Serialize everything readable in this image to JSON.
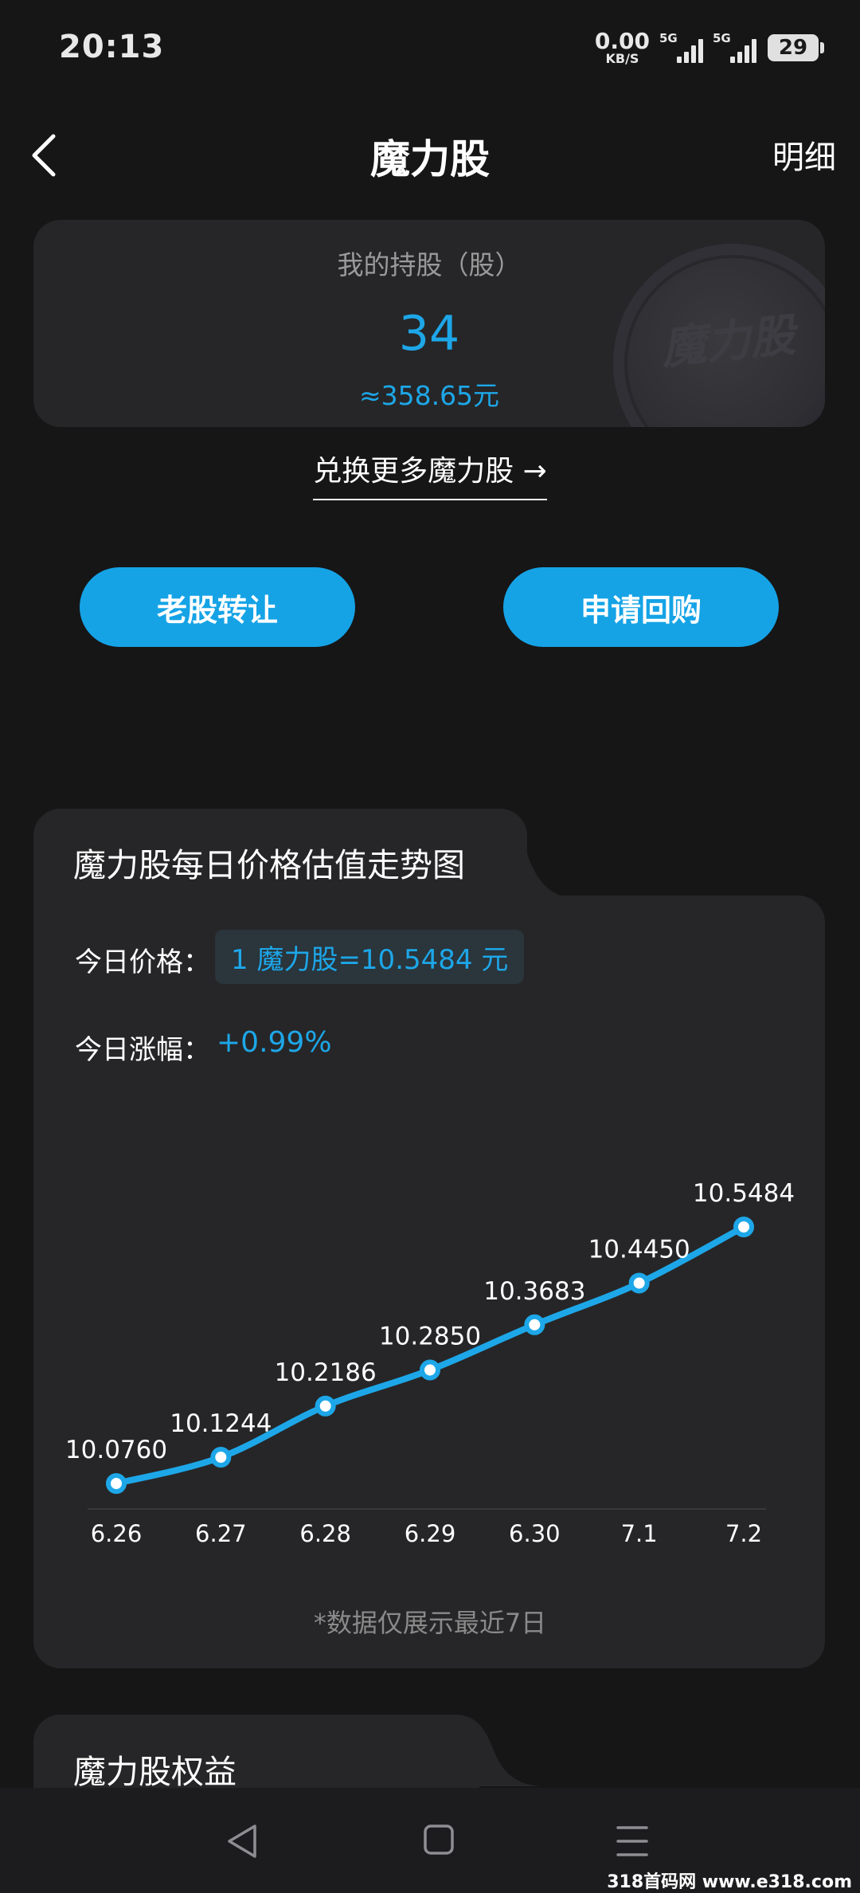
{
  "status_bar": {
    "time": "20:13",
    "net_speed": "0.00",
    "net_unit": "KB/S",
    "sim1": "5G",
    "sim2": "5G",
    "battery": "29"
  },
  "header": {
    "title": "魔力股",
    "detail_label": "明细",
    "back_icon": "chevron-left-icon"
  },
  "holdings": {
    "label": "我的持股（股）",
    "value": "34",
    "approx_value": "≈358.65元",
    "coin_text": "魔力股"
  },
  "exchange_link": "兑换更多魔力股 →",
  "actions": {
    "transfer_label": "老股转让",
    "buyback_label": "申请回购"
  },
  "trend": {
    "title": "魔力股每日价格估值走势图",
    "price_label": "今日价格：",
    "price_value": "1 魔力股=10.5484 元",
    "change_label": "今日涨幅：",
    "change_value": "+0.99%",
    "note": "*数据仅展示最近7日"
  },
  "chart_data": {
    "type": "line",
    "categories": [
      "6.26",
      "6.27",
      "6.28",
      "6.29",
      "6.30",
      "7.1",
      "7.2"
    ],
    "values": [
      10.076,
      10.1244,
      10.2186,
      10.285,
      10.3683,
      10.445,
      10.5484
    ],
    "labels": [
      "10.0760",
      "10.1244",
      "10.2186",
      "10.2850",
      "10.3683",
      "10.4450",
      "10.5484"
    ],
    "title": "",
    "xlabel": "",
    "ylabel": "",
    "grid": false,
    "color": "#1da7e8"
  },
  "rights": {
    "title": "魔力股权益"
  },
  "watermark": "318首码网 www.e318.com",
  "colors": {
    "background": "#161617",
    "card": "#262628",
    "accent": "#1da7e8",
    "button": "#15a3e6"
  }
}
